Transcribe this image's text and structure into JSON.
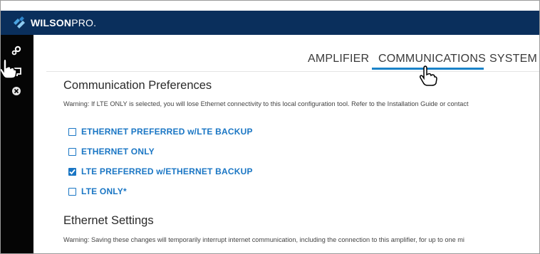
{
  "brand": {
    "name_bold": "WILSON",
    "name_light": "PRO."
  },
  "sidebar": {
    "icons": [
      "settings-icon",
      "monitor-icon",
      "close-circle-icon"
    ]
  },
  "tabs": [
    {
      "label": "AMPLIFIER",
      "active": false
    },
    {
      "label": "COMMUNICATIONS",
      "active": true
    },
    {
      "label": "SYSTEM",
      "active": false
    }
  ],
  "communication_preferences": {
    "title": "Communication Preferences",
    "warning": "Warning: If LTE ONLY is selected, you will lose Ethernet connectivity to this local configuration tool. Refer to the Installation Guide or contact",
    "options": [
      {
        "label": "ETHERNET PREFERRED w/LTE BACKUP",
        "checked": false
      },
      {
        "label": "ETHERNET ONLY",
        "checked": false
      },
      {
        "label": "LTE PREFERRED w/ETHERNET BACKUP",
        "checked": true
      },
      {
        "label": "LTE ONLY*",
        "checked": false
      }
    ]
  },
  "ethernet_settings": {
    "title": "Ethernet Settings",
    "warning": "Warning: Saving these changes will temporarily interrupt internet communication, including the connection to this amplifier, for up to one mi"
  },
  "colors": {
    "topbar": "#0a2f5c",
    "sidebar": "#050505",
    "accent": "#1a76c4",
    "tab_underline": "#1a83c9"
  }
}
